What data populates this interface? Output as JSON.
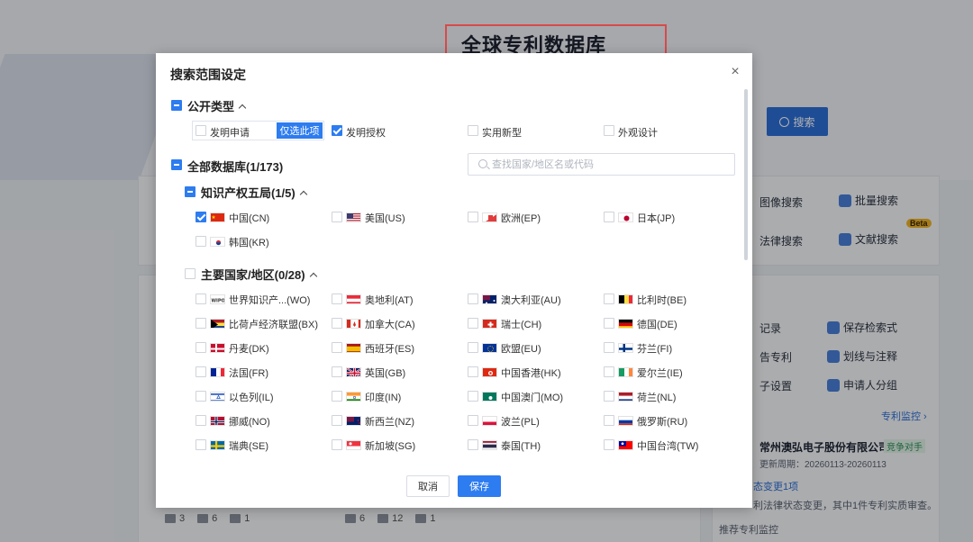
{
  "background": {
    "title": "全球专利数据库",
    "search_button": "搜索",
    "links": [
      "图像搜索",
      "批量搜索",
      "法律搜索",
      "文献搜索"
    ],
    "beta": "Beta",
    "side_links": [
      "记录",
      "保存检索式",
      "告专利",
      "划线与注释",
      "子设置",
      "申请人分组"
    ],
    "monitor": "专利监控 ›",
    "company": "常州澳弘电子股份有限公司",
    "company_tag": "竞争对手",
    "update_period": "更新周期：20260113-20260113",
    "change_count": "态变更1项",
    "change_text": "利法律状态变更，其中1件专利实质审查。",
    "recommend": "推荐专利监控",
    "stats_left": [
      "3",
      "6",
      "1"
    ],
    "stats_right": [
      "6",
      "12",
      "1"
    ]
  },
  "modal": {
    "title": "搜索范围设定",
    "publication": {
      "label": "公开类型",
      "options": [
        {
          "label": "发明申请",
          "checked": false
        },
        {
          "label": "发明授权",
          "checked": true
        },
        {
          "label": "实用新型",
          "checked": false
        },
        {
          "label": "外观设计",
          "checked": false
        }
      ],
      "only_this": "仅选此项"
    },
    "all_db_label": "全部数据库(1/173)",
    "search_placeholder": "查找国家/地区名或代码",
    "ip5": {
      "label": "知识产权五局(1/5)",
      "countries": [
        {
          "name": "中国(CN)",
          "checked": true,
          "flag": "cn"
        },
        {
          "name": "美国(US)",
          "checked": false,
          "flag": "us"
        },
        {
          "name": "欧洲(EP)",
          "checked": false,
          "flag": "ep"
        },
        {
          "name": "日本(JP)",
          "checked": false,
          "flag": "jp"
        },
        {
          "name": "韩国(KR)",
          "checked": false,
          "flag": "kr"
        }
      ]
    },
    "major": {
      "label": "主要国家/地区(0/28)",
      "countries": [
        {
          "name": "世界知识产...(WO)",
          "flag": "wo"
        },
        {
          "name": "奥地利(AT)",
          "flag": "at"
        },
        {
          "name": "澳大利亚(AU)",
          "flag": "au"
        },
        {
          "name": "比利时(BE)",
          "flag": "be"
        },
        {
          "name": "比荷卢经济联盟(BX)",
          "flag": "bx"
        },
        {
          "name": "加拿大(CA)",
          "flag": "ca"
        },
        {
          "name": "瑞士(CH)",
          "flag": "ch"
        },
        {
          "name": "德国(DE)",
          "flag": "de"
        },
        {
          "name": "丹麦(DK)",
          "flag": "dk"
        },
        {
          "name": "西班牙(ES)",
          "flag": "es"
        },
        {
          "name": "欧盟(EU)",
          "flag": "eu"
        },
        {
          "name": "芬兰(FI)",
          "flag": "fi"
        },
        {
          "name": "法国(FR)",
          "flag": "fr"
        },
        {
          "name": "英国(GB)",
          "flag": "gb"
        },
        {
          "name": "中国香港(HK)",
          "flag": "hk"
        },
        {
          "name": "爱尔兰(IE)",
          "flag": "ie"
        },
        {
          "name": "以色列(IL)",
          "flag": "il"
        },
        {
          "name": "印度(IN)",
          "flag": "in"
        },
        {
          "name": "中国澳门(MO)",
          "flag": "mo"
        },
        {
          "name": "荷兰(NL)",
          "flag": "nl"
        },
        {
          "name": "挪威(NO)",
          "flag": "no"
        },
        {
          "name": "新西兰(NZ)",
          "flag": "nz"
        },
        {
          "name": "波兰(PL)",
          "flag": "pl"
        },
        {
          "name": "俄罗斯(RU)",
          "flag": "ru"
        },
        {
          "name": "瑞典(SE)",
          "flag": "se"
        },
        {
          "name": "新加坡(SG)",
          "flag": "sg"
        },
        {
          "name": "泰国(TH)",
          "flag": "th"
        },
        {
          "name": "中国台湾(TW)",
          "flag": "tw"
        }
      ]
    },
    "cancel": "取消",
    "save": "保存"
  },
  "colors": {
    "accent": "#2d7cf0",
    "highlight_border": "#d84a4a"
  }
}
